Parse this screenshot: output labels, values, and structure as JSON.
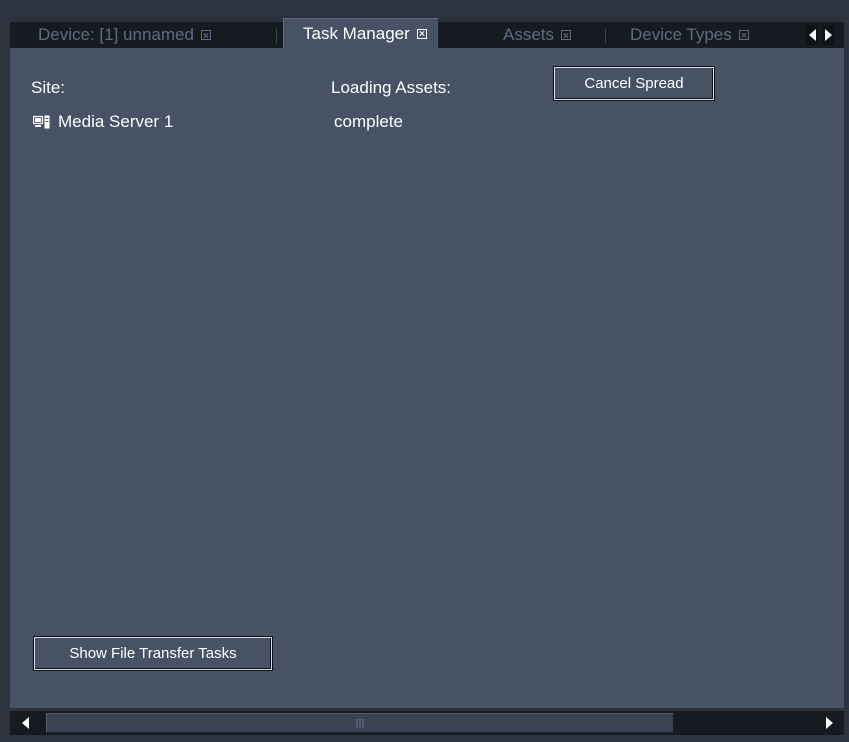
{
  "tabs": [
    {
      "label": "Device: [1] unnamed",
      "active": false
    },
    {
      "label": "Task Manager",
      "active": true
    },
    {
      "label": "Assets",
      "active": false
    },
    {
      "label": "Device Types",
      "active": false
    }
  ],
  "panel": {
    "site_header": "Site:",
    "loading_header": "Loading Assets:",
    "cancel_button": "Cancel Spread",
    "rows": [
      {
        "site": "Media Server 1",
        "icon": "server-icon",
        "status": "complete"
      }
    ],
    "show_tasks_button": "Show File Transfer Tasks"
  },
  "colors": {
    "panel_bg": "#475264",
    "tabbar_bg": "#161b22",
    "inactive_tab_text": "#5f6c80",
    "text": "#ffffff"
  }
}
